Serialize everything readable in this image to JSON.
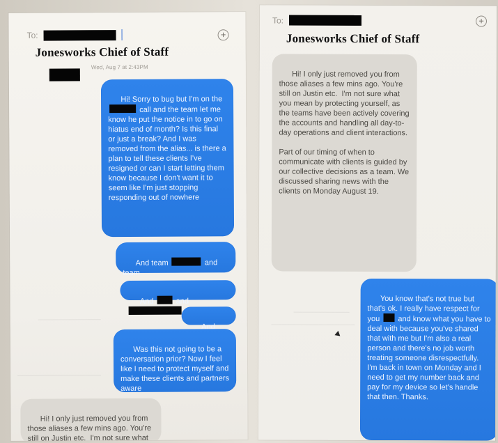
{
  "left_screen": {
    "to_label": "To:",
    "title_overlay": "Jonesworks Chief of Staff",
    "timestamp": "Wed, Aug 7 at 2:43PM",
    "messages": [
      {
        "type": "out",
        "parts": [
          "Hi! Sorry to bug but I'm on the ",
          " call and the team let me know he put the notice in to go on hiatus end of month? Is this final or just a break? And I was removed from the alias... is there a plan to tell these clients I've resigned or can I start letting them know because I don't want it to seem like I'm just stopping responding out of nowhere"
        ]
      },
      {
        "type": "out",
        "parts": [
          "And team ",
          " and team"
        ]
      },
      {
        "type": "out",
        "parts": [
          "And ",
          " and "
        ]
      },
      {
        "type": "out",
        "parts": [
          "And "
        ]
      },
      {
        "type": "out",
        "parts": [
          "Was this not going to be a conversation prior? Now I feel like I need to protect myself and make these clients and partners aware"
        ]
      },
      {
        "type": "in",
        "parts": [
          "Hi! I only just removed you from those aliases a few mins ago. You're still on Justin etc.  I'm not sure what"
        ]
      }
    ]
  },
  "right_screen": {
    "to_label": "To:",
    "title_overlay": "Jonesworks Chief of Staff",
    "messages": [
      {
        "type": "in",
        "text": "Hi! I only just removed you from those aliases a few mins ago. You're still on Justin etc.  I'm not sure what you mean by protecting yourself, as the teams have been actively covering the accounts and handling all day-to-day operations and client interactions.\n\nPart of our timing of when to communicate with clients is guided by our collective decisions as a team. We discussed sharing news with the clients on Monday August 19."
      },
      {
        "type": "out",
        "parts": [
          "You know that's not true but that's ok. I really have respect for you ",
          " and know what you have to deal with because you've shared that with me but I'm also a real person and there's no job worth treating someone disrespectfully.  I'm back in town on Monday and I need to get my number back and pay for my device so let's handle that then. Thanks."
        ]
      }
    ]
  },
  "icons": {
    "plus": "plus-circle-icon",
    "cursor": "mouse-cursor-icon"
  },
  "colors": {
    "outgoing_bubble": "#2f83eb",
    "incoming_bubble": "#dcd9d3",
    "redaction": "#050505"
  }
}
